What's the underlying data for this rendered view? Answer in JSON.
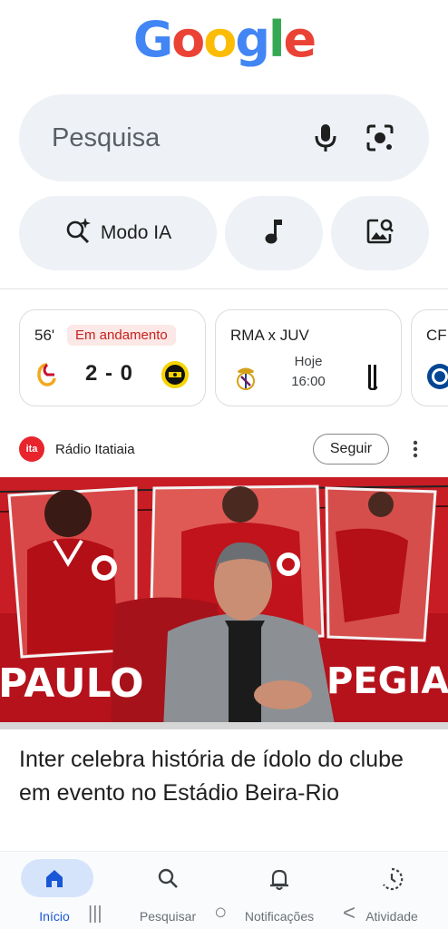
{
  "logo": {
    "letters": [
      "G",
      "o",
      "o",
      "g",
      "l",
      "e"
    ],
    "colors": [
      "#4285F4",
      "#EA4335",
      "#FBBC05",
      "#4285F4",
      "#34A853",
      "#EA4335"
    ]
  },
  "search": {
    "placeholder": "Pesquisa",
    "icons": [
      "microphone-icon",
      "lens-camera-icon"
    ]
  },
  "chips": {
    "ai_mode_label": "Modo IA",
    "icons": [
      "sparkle-search-icon",
      "music-note-icon",
      "image-search-icon"
    ]
  },
  "scores": {
    "card1": {
      "minute": "56'",
      "status": "Em andamento",
      "score": "2 - 0",
      "status_color": "#c5221f"
    },
    "card2": {
      "title": "RMA x JUV",
      "day": "Hoje",
      "time": "16:00"
    },
    "card3": {
      "title": "CF"
    }
  },
  "news": {
    "source": "Rádio Itatiaia",
    "source_logo_text": "ita",
    "follow_label": "Seguir",
    "headline": "Inter celebra história de ídolo do clube em evento no Estádio Beira-Rio",
    "image_words": [
      "PAULO",
      "PEGIAN"
    ]
  },
  "bottom_nav": {
    "items": [
      {
        "label": "Início",
        "icon": "home-icon"
      },
      {
        "label": "Pesquisar",
        "icon": "search-icon"
      },
      {
        "label": "Notificações",
        "icon": "bell-icon"
      },
      {
        "label": "Atividade",
        "icon": "activity-icon"
      }
    ],
    "active_color": "#1a57d6"
  },
  "system_nav": {
    "recents": "|||",
    "home": "○",
    "back": "<"
  }
}
